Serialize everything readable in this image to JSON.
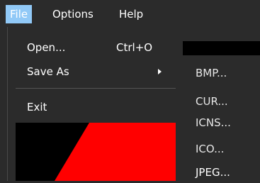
{
  "menubar": {
    "items": [
      {
        "label": "File",
        "active": true
      },
      {
        "label": "Options"
      },
      {
        "label": "Help"
      }
    ]
  },
  "file_menu": {
    "items": [
      {
        "label": "Open...",
        "shortcut": "Ctrl+O"
      },
      {
        "label": "Save As",
        "has_submenu": true
      },
      {
        "label": "Exit"
      }
    ]
  },
  "save_as_submenu": {
    "items": [
      "BMP...",
      "CUR...",
      "ICNS...",
      "ICO...",
      "JPEG..."
    ]
  },
  "colors": {
    "accent": "#91c9f7",
    "background": "#2b2b2b",
    "canvas_red": "#ff0000",
    "canvas_black": "#000000"
  }
}
